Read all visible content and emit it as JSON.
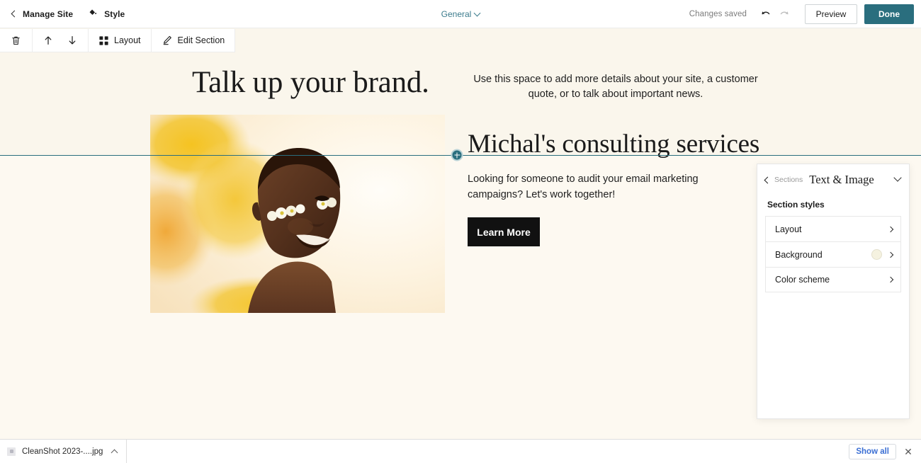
{
  "header": {
    "manage_site_label": "Manage Site",
    "style_label": "Style",
    "general_label": "General",
    "changes_saved_label": "Changes saved",
    "undo_icon": "undo-arrow-icon",
    "redo_icon": "redo-arrow-icon",
    "preview_label": "Preview",
    "done_label": "Done",
    "done_color": "#2a6e7e",
    "general_color": "#3b7b8c"
  },
  "section_toolbar": {
    "delete_icon": "trash-icon",
    "move_up_icon": "arrow-up-icon",
    "move_down_icon": "arrow-down-icon",
    "layout_label": "Layout",
    "layout_icon": "grid-icon",
    "edit_section_label": "Edit Section",
    "edit_section_icon": "pencil-icon"
  },
  "canvas": {
    "hero": {
      "title": "Talk up your brand.",
      "subtitle": "Use this space to add more details about your site, a customer quote, or to talk about important news.",
      "background_color": "#faf6ec"
    },
    "divider": {
      "add_section_icon": "plus-circle-icon",
      "line_color": "#2a6e7e"
    },
    "text_image_section": {
      "image_alt": "Smiling woman with white flowers under her eyes on a yellow background",
      "title": "Michal's consulting services",
      "body": "Looking for someone to audit your email marketing campaigns? Let's work together!",
      "button_label": "Learn More",
      "background_color": "#fdf9f1"
    }
  },
  "panel": {
    "back_label": "Sections",
    "title": "Text & Image",
    "collapse_icon": "chevron-down-icon",
    "section_styles_label": "Section styles",
    "rows": [
      {
        "label": "Layout",
        "has_swatch": false
      },
      {
        "label": "Background",
        "has_swatch": true,
        "swatch_color": "#f5f2e0"
      },
      {
        "label": "Color scheme",
        "has_swatch": false
      }
    ]
  },
  "download_bar": {
    "file_name": "CleanShot 2023-....jpg",
    "file_menu_icon": "caret-up-icon",
    "show_all_label": "Show all",
    "close_icon": "close-icon"
  }
}
